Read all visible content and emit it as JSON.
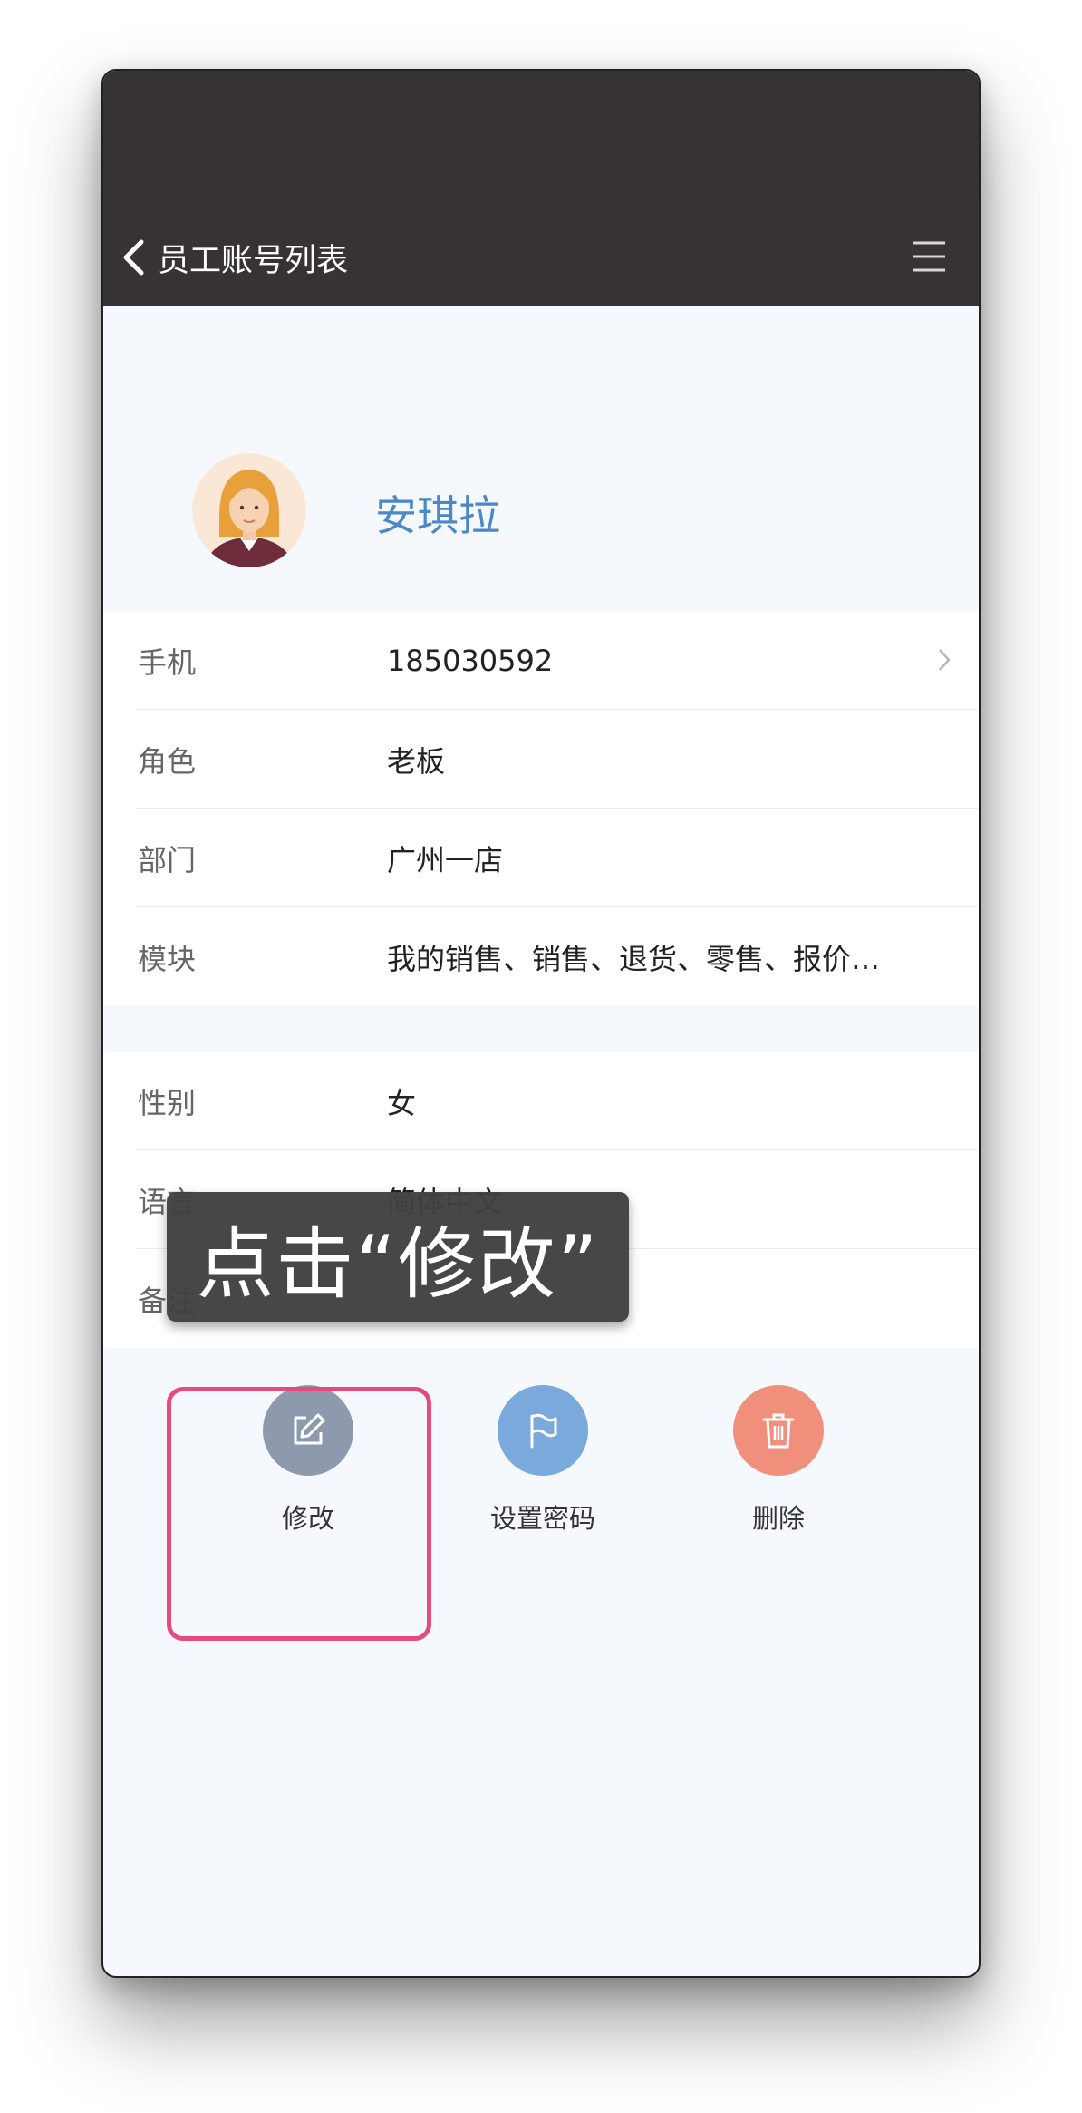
{
  "nav": {
    "back_label": "员工账号列表",
    "back_icon": "chevron-left-icon",
    "menu_icon": "hamburger-menu-icon"
  },
  "profile": {
    "name": "安琪拉",
    "avatar_icon": "female-avatar-icon"
  },
  "info_section": [
    {
      "label": "手机",
      "value": "185030592",
      "has_chevron": true
    },
    {
      "label": "角色",
      "value": "老板"
    },
    {
      "label": "部门",
      "value": "广州一店"
    },
    {
      "label": "模块",
      "value": "我的销售、销售、退货、零售、报价…"
    }
  ],
  "detail_section": [
    {
      "label": "性别",
      "value": "女"
    },
    {
      "label": "语言",
      "value": "简体中文"
    },
    {
      "label": "备注",
      "value": ""
    }
  ],
  "actions": [
    {
      "label": "修改",
      "icon": "edit-icon",
      "color": "#8e99ad"
    },
    {
      "label": "设置密码",
      "icon": "flag-icon",
      "color": "#7aa9db"
    },
    {
      "label": "删除",
      "icon": "trash-icon",
      "color": "#f0907c"
    }
  ],
  "overlay": {
    "tooltip_text": "点击“修改”",
    "highlight_color": "#e84a80"
  }
}
